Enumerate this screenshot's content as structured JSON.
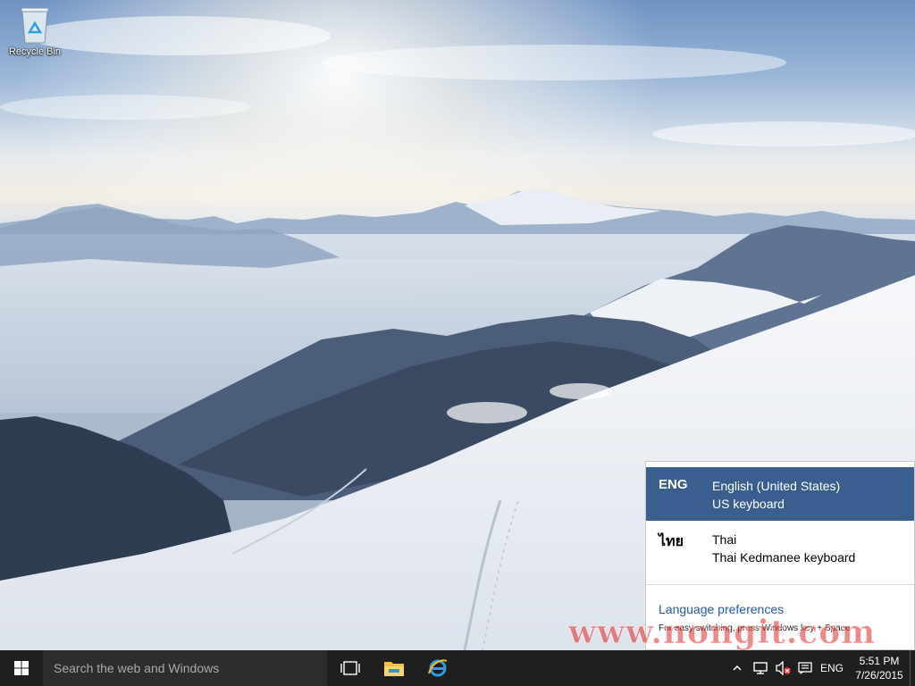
{
  "desktop": {
    "icons": [
      {
        "label": "Recycle Bin",
        "icon": "recycle-bin-icon"
      }
    ]
  },
  "language_flyout": {
    "languages": [
      {
        "code": "ENG",
        "name": "English (United States)",
        "keyboard": "US keyboard",
        "selected": true
      },
      {
        "code": "ไทย",
        "name": "Thai",
        "keyboard": "Thai Kedmanee keyboard",
        "selected": false
      }
    ],
    "preferences_link": "Language preferences",
    "hint": "For easy switching, press Windows key + Space"
  },
  "watermark": {
    "text": "www.nongit.com"
  },
  "taskbar": {
    "start_icon": "windows-logo-icon",
    "search_placeholder": "Search the web and Windows",
    "pinned": [
      {
        "icon": "task-view-icon"
      },
      {
        "icon": "file-explorer-icon"
      },
      {
        "icon": "internet-explorer-icon"
      }
    ],
    "tray": {
      "icons": [
        "chevron-up-icon",
        "network-icon",
        "volume-muted-icon",
        "action-center-icon"
      ],
      "language": "ENG",
      "time": "5:51 PM",
      "date": "7/26/2015"
    }
  },
  "colors": {
    "accent": "#3a5f8f",
    "link": "#235aa5",
    "taskbar": "#1f1f1f",
    "search_box": "#2d2d2d"
  }
}
